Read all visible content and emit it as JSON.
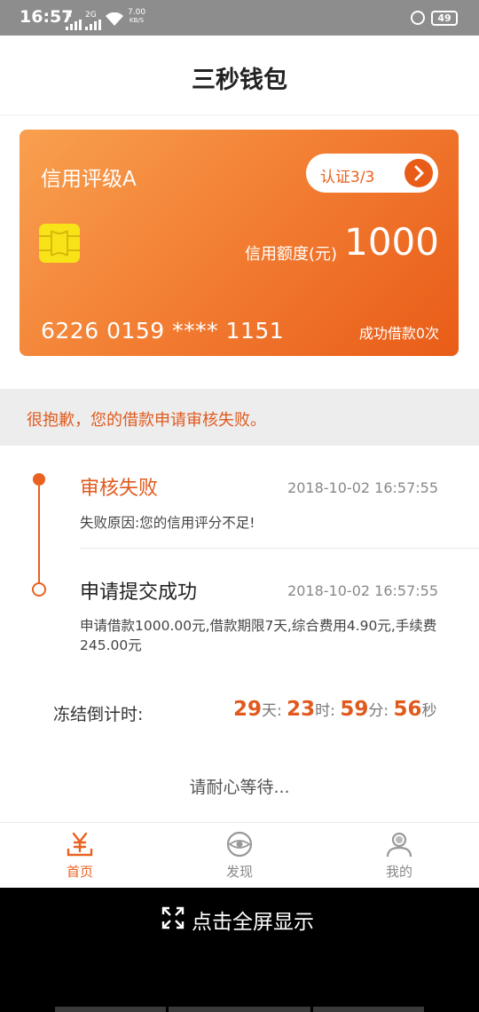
{
  "status_bar": {
    "time": "16:57",
    "signal_1": "H",
    "signal_2": "2G",
    "speed_value": "7.00",
    "speed_unit": "KB/S",
    "battery": "49"
  },
  "header": {
    "title": "三秒钱包"
  },
  "card": {
    "rating": "信用评级A",
    "cert_label": "认证3/3",
    "limit_label": "信用额度(元)",
    "limit_value": "1000",
    "card_number": "6226 0159 **** 1151",
    "success_count": "成功借款0次"
  },
  "notice": {
    "text": "很抱歉，您的借款申请审核失败。"
  },
  "timeline": [
    {
      "title": "审核失败",
      "time": "2018-10-02 16:57:55",
      "desc": "失败原因:您的信用评分不足!"
    },
    {
      "title": "申请提交成功",
      "time": "2018-10-02 16:57:55",
      "desc": "申请借款1000.00元,借款期限7天,综合费用4.90元,手续费245.00元"
    }
  ],
  "countdown": {
    "label": "冻结倒计时:",
    "days": "29",
    "days_unit": "天:",
    "hours": "23",
    "hours_unit": "时:",
    "minutes": "59",
    "minutes_unit": "分:",
    "seconds": "56",
    "seconds_unit": "秒"
  },
  "wait_text": "请耐心等待...",
  "tabs": [
    {
      "label": "首页",
      "icon": "yen-icon",
      "active": true
    },
    {
      "label": "发现",
      "icon": "discover-icon",
      "active": false
    },
    {
      "label": "我的",
      "icon": "profile-icon",
      "active": false
    }
  ],
  "fullscreen": {
    "label": "点击全屏显示",
    "icon": "expand-icon"
  },
  "colors": {
    "accent": "#e96120",
    "card_start": "#f8a04f",
    "card_end": "#e95c18",
    "chip": "#f8e318"
  }
}
